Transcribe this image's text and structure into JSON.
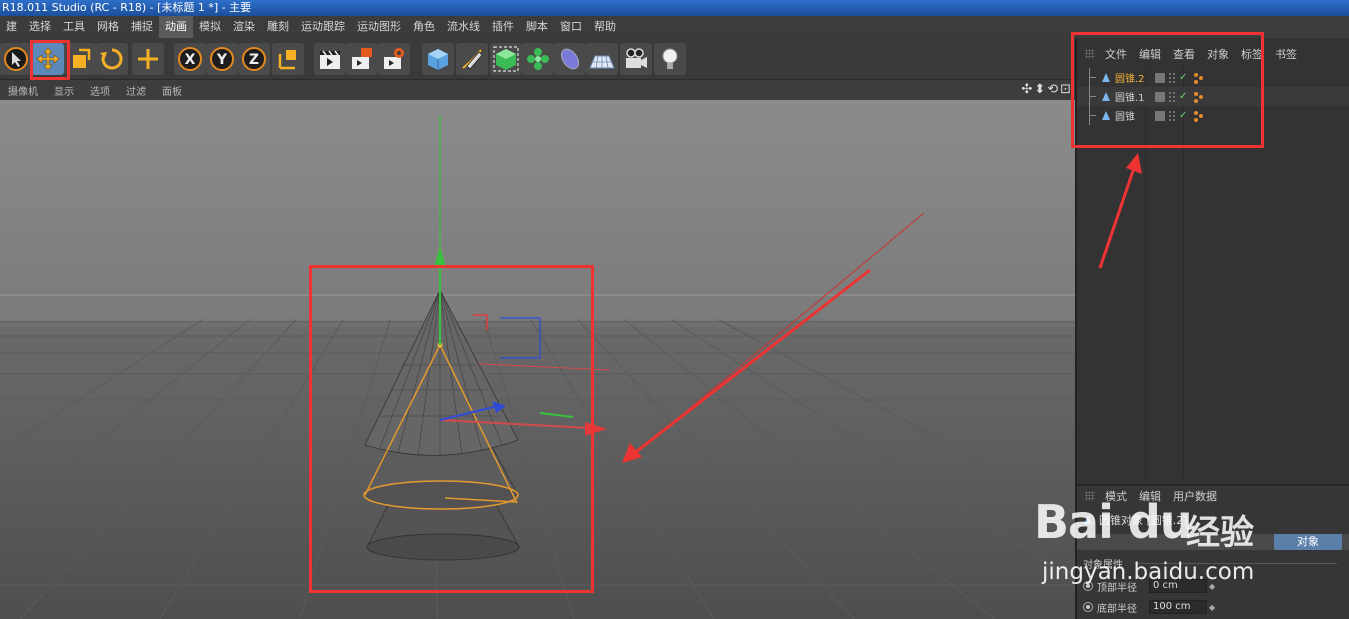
{
  "window": {
    "title": "R18.011 Studio (RC - R18) - [未标题 1 *] - 主要"
  },
  "menu": {
    "items": [
      "建",
      "选择",
      "工具",
      "网格",
      "捕捉",
      "动画",
      "模拟",
      "渲染",
      "雕刻",
      "运动跟踪",
      "运动图形",
      "角色",
      "流水线",
      "插件",
      "脚本",
      "窗口",
      "帮助"
    ],
    "active_index": 5
  },
  "toolbar": {
    "tools": [
      "select-arrow-icon",
      "move-icon",
      "scale-icon",
      "rotate-icon",
      "add-move-icon",
      "x-axis-lock-icon",
      "y-axis-lock-icon",
      "z-axis-lock-icon",
      "coordinate-system-icon",
      "render-view-icon",
      "render-picture-viewer-icon",
      "render-settings-icon",
      "cube-icon",
      "pen-icon",
      "subdivision-icon",
      "cloner-icon",
      "deformer-icon",
      "floor-icon",
      "camera-icon",
      "light-icon"
    ],
    "letters": {
      "x": "X",
      "y": "Y",
      "z": "Z"
    }
  },
  "viewport": {
    "menu": [
      "摄像机",
      "显示",
      "选项",
      "过滤",
      "面板"
    ],
    "nav_icons": "✣⬍⟲⊡"
  },
  "object_manager": {
    "menu": [
      "文件",
      "编辑",
      "查看",
      "对象",
      "标签",
      "书签"
    ],
    "objects": [
      {
        "name": "圆锥.2",
        "selected": true
      },
      {
        "name": "圆锥.1",
        "selected": false
      },
      {
        "name": "圆锥",
        "selected": false
      }
    ]
  },
  "attributes": {
    "menu": [
      "模式",
      "编辑",
      "用户数据"
    ],
    "header": "圆锥对象 [圆锥.2]",
    "active_tab": "对象",
    "section": "对象属性",
    "props": [
      {
        "label": "顶部半径",
        "value": "0 cm"
      },
      {
        "label": "底部半径",
        "value": "100 cm"
      }
    ]
  },
  "watermark": {
    "logo": "Bai du",
    "cn": "经验",
    "url": "jingyan.baidu.com"
  },
  "colors": {
    "annotation": "#ee3333",
    "selection": "#f0b33c",
    "accent_blue": "#5a7fa8"
  }
}
